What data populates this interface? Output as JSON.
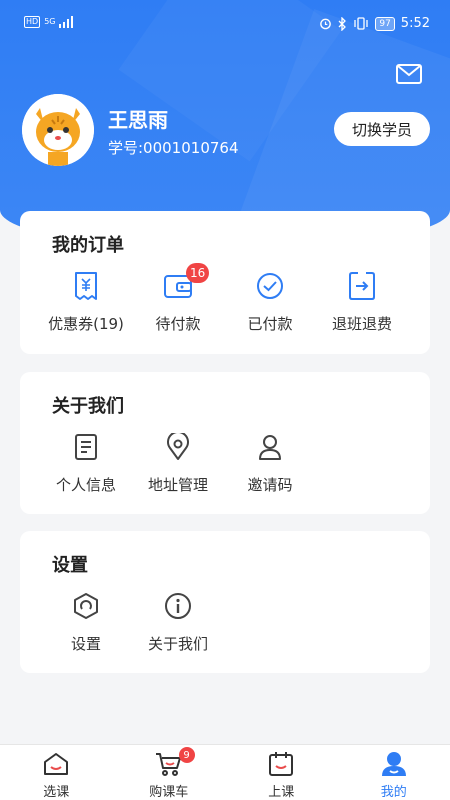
{
  "status_bar": {
    "left_badge": "HD",
    "network": "5G",
    "battery": "97",
    "time": "5:52"
  },
  "profile": {
    "name": "王思雨",
    "student_id": "学号:0001010764",
    "switch_label": "切换学员"
  },
  "orders": {
    "title": "我的订单",
    "items": [
      {
        "label": "优惠券(19)",
        "icon": "coupon-icon"
      },
      {
        "label": "待付款",
        "icon": "wallet-icon",
        "badge": "16"
      },
      {
        "label": "已付款",
        "icon": "check-circle-icon"
      },
      {
        "label": "退班退费",
        "icon": "refund-icon"
      }
    ]
  },
  "about": {
    "title": "关于我们",
    "items": [
      {
        "label": "个人信息",
        "icon": "document-icon"
      },
      {
        "label": "地址管理",
        "icon": "location-icon"
      },
      {
        "label": "邀请码",
        "icon": "person-icon"
      }
    ]
  },
  "settings": {
    "title": "设置",
    "items": [
      {
        "label": "设置",
        "icon": "hexagon-settings-icon"
      },
      {
        "label": "关于我们",
        "icon": "info-icon"
      }
    ]
  },
  "tabs": [
    {
      "label": "选课",
      "icon": "home-icon"
    },
    {
      "label": "购课车",
      "icon": "cart-icon",
      "badge": "9"
    },
    {
      "label": "上课",
      "icon": "calendar-icon"
    },
    {
      "label": "我的",
      "icon": "profile-icon",
      "active": true
    }
  ],
  "colors": {
    "primary": "#2f7df4",
    "badge": "#f04444",
    "icon_stroke": "#444444"
  }
}
